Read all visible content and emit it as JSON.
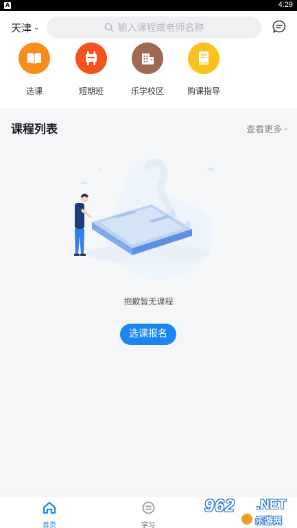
{
  "status_bar": {
    "time": "4:29",
    "sim_letter": "A"
  },
  "header": {
    "city": "天津",
    "search_placeholder": "输入课程或老师名称",
    "search_icon": "search-icon",
    "message_icon": "message-icon"
  },
  "categories": [
    {
      "label": "选课",
      "icon": "book-icon",
      "color": "#f88c1c"
    },
    {
      "label": "短期班",
      "icon": "easel-icon",
      "color": "#f4541c"
    },
    {
      "label": "乐学校区",
      "icon": "building-icon",
      "color": "#a06a52"
    },
    {
      "label": "购课指导",
      "icon": "guide-book-icon",
      "color": "#fbc21e"
    }
  ],
  "section": {
    "title": "课程列表",
    "more": "查看更多"
  },
  "empty_state": {
    "text": "抱歉暂无课程",
    "button": "选课报名"
  },
  "tabbar": {
    "items": [
      {
        "label": "首页",
        "icon": "home-icon",
        "active": true
      },
      {
        "label": "学习",
        "icon": "study-icon",
        "active": false
      }
    ]
  },
  "watermark": {
    "number": "962",
    "net": ".NET",
    "name": "乐游网"
  },
  "colors": {
    "accent": "#1b86f0"
  }
}
